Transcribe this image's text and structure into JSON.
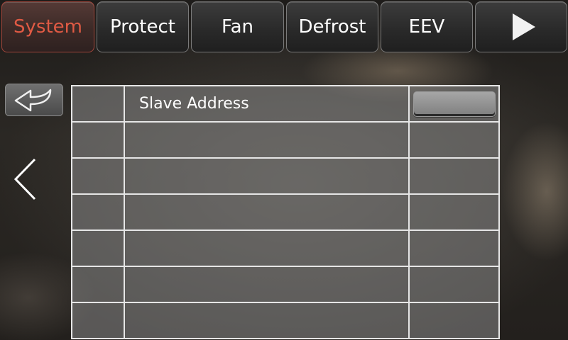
{
  "tabs": [
    {
      "label": "System",
      "active": true
    },
    {
      "label": "Protect",
      "active": false
    },
    {
      "label": "Fan",
      "active": false
    },
    {
      "label": "Defrost",
      "active": false
    },
    {
      "label": "EEV",
      "active": false
    }
  ],
  "nav": {
    "next_icon": "play-icon",
    "back_icon": "return-arrow-icon",
    "prev_icon": "chevron-left-icon"
  },
  "table": {
    "rows": [
      {
        "index": "",
        "name": "Slave Address",
        "value": ""
      },
      {
        "index": "",
        "name": "",
        "value": ""
      },
      {
        "index": "",
        "name": "",
        "value": ""
      },
      {
        "index": "",
        "name": "",
        "value": ""
      },
      {
        "index": "",
        "name": "",
        "value": ""
      },
      {
        "index": "",
        "name": "",
        "value": ""
      },
      {
        "index": "",
        "name": "",
        "value": ""
      }
    ]
  },
  "colors": {
    "active_tab_text": "#e05a44",
    "tab_text": "#ffffff",
    "grid_line": "#e6e6e6"
  }
}
